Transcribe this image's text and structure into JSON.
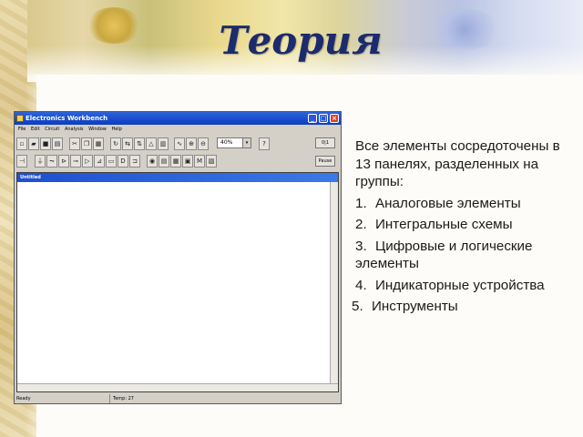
{
  "slide": {
    "title": "Теория",
    "lead_text": "Все элементы сосредоточены в 13 панелях, разделенных на группы:",
    "items": [
      {
        "num": "1.",
        "text": "Аналоговые элементы"
      },
      {
        "num": "2.",
        "text": "Интегральные схемы"
      },
      {
        "num": "3.",
        "text": "Цифровые и логические элементы"
      },
      {
        "num": "4.",
        "text": "Индикаторные устройства"
      },
      {
        "num": "5.",
        "text": "Инструменты"
      }
    ]
  },
  "app_window": {
    "title": "Electronics Workbench",
    "menu": [
      "File",
      "Edit",
      "Circuit",
      "Analysis",
      "Window",
      "Help"
    ],
    "zoom_value": "40%",
    "pause_label": "Pause",
    "child_window_title": "Untitled",
    "status_left": "Ready",
    "status_temp": "Temp: 27"
  },
  "colors": {
    "title_color": "#1c2a6e",
    "titlebar_blue": "#0b3cc1",
    "window_gray": "#d4d0c8"
  }
}
